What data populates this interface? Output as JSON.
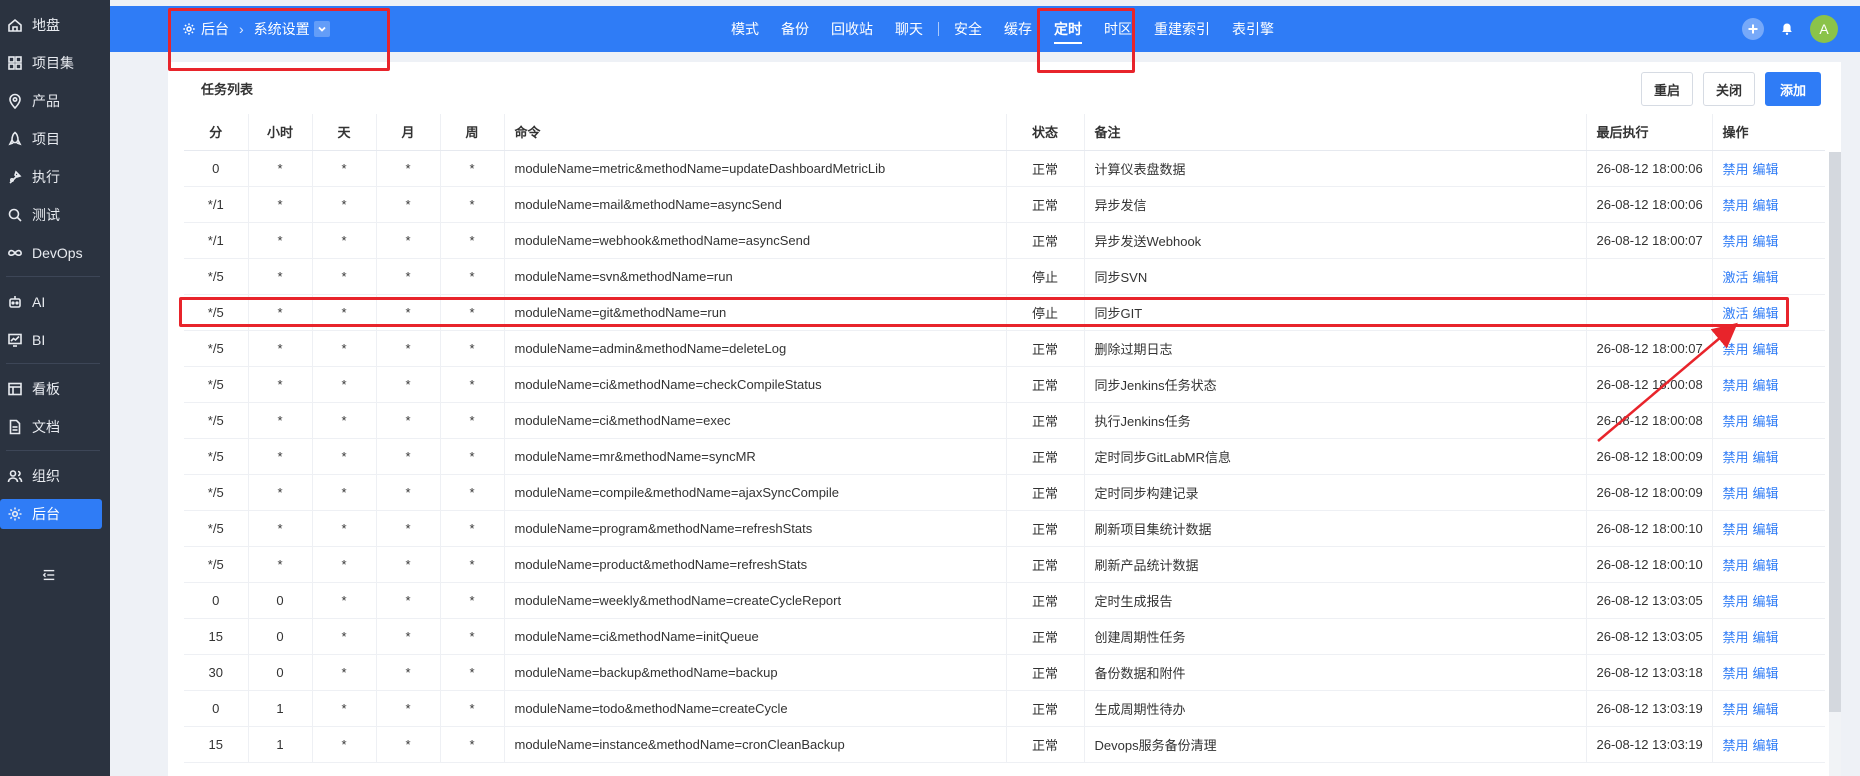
{
  "sidebar": {
    "items": [
      {
        "label": "地盘",
        "icon": "home-icon"
      },
      {
        "label": "项目集",
        "icon": "grid-icon"
      },
      {
        "label": "产品",
        "icon": "location-icon"
      },
      {
        "label": "项目",
        "icon": "rocket-icon"
      },
      {
        "label": "执行",
        "icon": "flag-icon"
      },
      {
        "label": "测试",
        "icon": "search-icon"
      },
      {
        "label": "DevOps",
        "icon": "infinity-icon"
      },
      {
        "label": "AI",
        "icon": "robot-icon"
      },
      {
        "label": "BI",
        "icon": "chart-icon"
      },
      {
        "label": "看板",
        "icon": "kanban-icon"
      },
      {
        "label": "文档",
        "icon": "document-icon"
      },
      {
        "label": "组织",
        "icon": "users-icon"
      },
      {
        "label": "后台",
        "icon": "gear-icon",
        "active": true
      }
    ]
  },
  "header": {
    "breadcrumb_root": "后台",
    "breadcrumb_sep": "›",
    "breadcrumb_current": "系统设置",
    "nav": [
      {
        "label": "模式"
      },
      {
        "label": "备份"
      },
      {
        "label": "回收站"
      },
      {
        "label": "聊天"
      },
      {
        "label": "安全"
      },
      {
        "label": "缓存"
      },
      {
        "label": "定时",
        "active": true
      },
      {
        "label": "时区"
      },
      {
        "label": "重建索引"
      },
      {
        "label": "表引擎"
      }
    ],
    "avatar": "A"
  },
  "panel": {
    "title": "任务列表",
    "buttons": {
      "restart": "重启",
      "close": "关闭",
      "add": "添加"
    }
  },
  "table": {
    "columns": [
      "分",
      "小时",
      "天",
      "月",
      "周",
      "命令",
      "状态",
      "备注",
      "最后执行",
      "操作"
    ],
    "rows": [
      [
        "0",
        "*",
        "*",
        "*",
        "*",
        "moduleName=metric&methodName=updateDashboardMetricLib",
        "正常",
        "计算仪表盘数据",
        "26-08-12 18:00:06",
        "禁用",
        "编辑"
      ],
      [
        "*/1",
        "*",
        "*",
        "*",
        "*",
        "moduleName=mail&methodName=asyncSend",
        "正常",
        "异步发信",
        "26-08-12 18:00:06",
        "禁用",
        "编辑"
      ],
      [
        "*/1",
        "*",
        "*",
        "*",
        "*",
        "moduleName=webhook&methodName=asyncSend",
        "正常",
        "异步发送Webhook",
        "26-08-12 18:00:07",
        "禁用",
        "编辑"
      ],
      [
        "*/5",
        "*",
        "*",
        "*",
        "*",
        "moduleName=svn&methodName=run",
        "停止",
        "同步SVN",
        "",
        "激活",
        "编辑"
      ],
      [
        "*/5",
        "*",
        "*",
        "*",
        "*",
        "moduleName=git&methodName=run",
        "停止",
        "同步GIT",
        "",
        "激活",
        "编辑"
      ],
      [
        "*/5",
        "*",
        "*",
        "*",
        "*",
        "moduleName=admin&methodName=deleteLog",
        "正常",
        "删除过期日志",
        "26-08-12 18:00:07",
        "禁用",
        "编辑"
      ],
      [
        "*/5",
        "*",
        "*",
        "*",
        "*",
        "moduleName=ci&methodName=checkCompileStatus",
        "正常",
        "同步Jenkins任务状态",
        "26-08-12 18:00:08",
        "禁用",
        "编辑"
      ],
      [
        "*/5",
        "*",
        "*",
        "*",
        "*",
        "moduleName=ci&methodName=exec",
        "正常",
        "执行Jenkins任务",
        "26-08-12 18:00:08",
        "禁用",
        "编辑"
      ],
      [
        "*/5",
        "*",
        "*",
        "*",
        "*",
        "moduleName=mr&methodName=syncMR",
        "正常",
        "定时同步GitLabMR信息",
        "26-08-12 18:00:09",
        "禁用",
        "编辑"
      ],
      [
        "*/5",
        "*",
        "*",
        "*",
        "*",
        "moduleName=compile&methodName=ajaxSyncCompile",
        "正常",
        "定时同步构建记录",
        "26-08-12 18:00:09",
        "禁用",
        "编辑"
      ],
      [
        "*/5",
        "*",
        "*",
        "*",
        "*",
        "moduleName=program&methodName=refreshStats",
        "正常",
        "刷新项目集统计数据",
        "26-08-12 18:00:10",
        "禁用",
        "编辑"
      ],
      [
        "*/5",
        "*",
        "*",
        "*",
        "*",
        "moduleName=product&methodName=refreshStats",
        "正常",
        "刷新产品统计数据",
        "26-08-12 18:00:10",
        "禁用",
        "编辑"
      ],
      [
        "0",
        "0",
        "*",
        "*",
        "*",
        "moduleName=weekly&methodName=createCycleReport",
        "正常",
        "定时生成报告",
        "26-08-12 13:03:05",
        "禁用",
        "编辑"
      ],
      [
        "15",
        "0",
        "*",
        "*",
        "*",
        "moduleName=ci&methodName=initQueue",
        "正常",
        "创建周期性任务",
        "26-08-12 13:03:05",
        "禁用",
        "编辑"
      ],
      [
        "30",
        "0",
        "*",
        "*",
        "*",
        "moduleName=backup&methodName=backup",
        "正常",
        "备份数据和附件",
        "26-08-12 13:03:18",
        "禁用",
        "编辑"
      ],
      [
        "0",
        "1",
        "*",
        "*",
        "*",
        "moduleName=todo&methodName=createCycle",
        "正常",
        "生成周期性待办",
        "26-08-12 13:03:19",
        "禁用",
        "编辑"
      ],
      [
        "15",
        "1",
        "*",
        "*",
        "*",
        "moduleName=instance&methodName=cronCleanBackup",
        "正常",
        "Devops服务备份清理",
        "26-08-12 13:03:19",
        "禁用",
        "编辑"
      ]
    ]
  },
  "colors": {
    "accent": "#2f7cf6",
    "sidebar_bg": "#2b3340",
    "annotation": "#e8242b"
  }
}
